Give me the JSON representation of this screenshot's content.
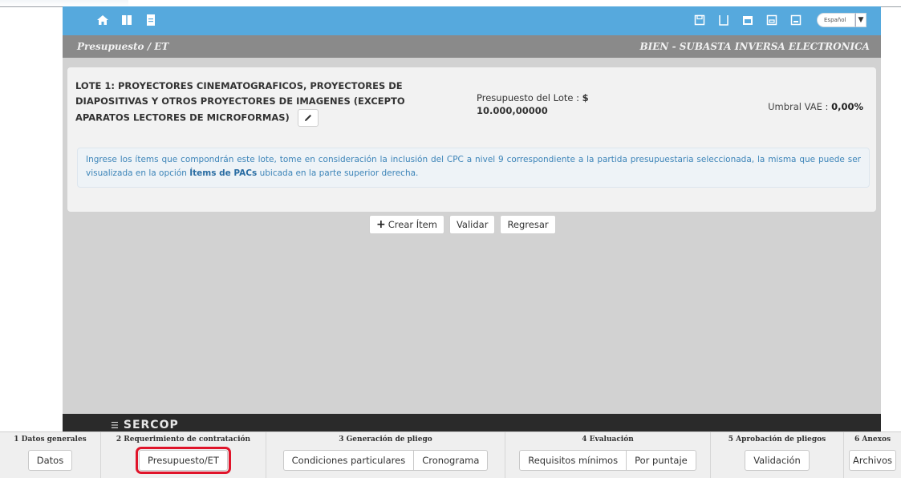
{
  "topbar": {
    "language": "Español",
    "language_arrow": "▼",
    "colors": {
      "bar": "#56a9dd",
      "subbar": "#8a8a8a"
    }
  },
  "subbar": {
    "left": "Presupuesto / ET",
    "right": "BIEN - SUBASTA INVERSA ELECTRONICA"
  },
  "lote": {
    "title": "LOTE 1: PROYECTORES CINEMATOGRAFICOS, PROYECTORES DE DIAPOSITIVAS Y OTROS PROYECTORES DE IMAGENES (EXCEPTO APARATOS LECTORES DE MICROFORMAS)",
    "budget_label": "Presupuesto del Lote :",
    "currency": "$",
    "budget_value": "10.000,00000",
    "umbral_label": "Umbral VAE :",
    "umbral_value": "0,00%"
  },
  "info": {
    "text_before": "Ingrese los ítems que compondrán este lote, tome en consideración la inclusión del CPC a nivel 9 correspondiente a la partida presupuestaria seleccionada, la misma que puede ser visualizada en la opción ",
    "link": "Ítems de PACs",
    "text_after": " ubicada en la parte superior derecha."
  },
  "actions": {
    "create_plus": "+",
    "create": "Crear Ítem",
    "validate": "Validar",
    "back": "Regresar"
  },
  "footer": {
    "logo": "SERCOP",
    "logo_mark": "☰"
  },
  "steps": [
    {
      "title": "1 Datos generales",
      "buttons": [
        "Datos"
      ]
    },
    {
      "title": "2 Requerimiento de contratación",
      "buttons": [
        "Presupuesto/ET"
      ]
    },
    {
      "title": "3 Generación de pliego",
      "buttons": [
        "Condiciones particulares",
        "Cronograma"
      ]
    },
    {
      "title": "4 Evaluación",
      "buttons": [
        "Requisitos mínimos",
        "Por puntaje"
      ]
    },
    {
      "title": "5 Aprobación de pliegos",
      "buttons": [
        "Validación"
      ]
    },
    {
      "title": "6 Anexos",
      "buttons": [
        "Archivos"
      ]
    }
  ]
}
